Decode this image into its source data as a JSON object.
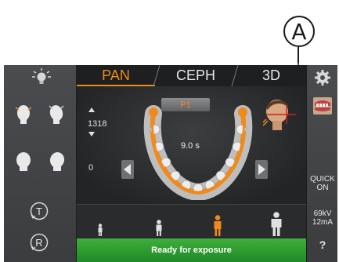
{
  "callout": {
    "label": "A"
  },
  "tabs": [
    {
      "label": "PAN",
      "active": true
    },
    {
      "label": "CEPH",
      "active": false
    },
    {
      "label": "3D",
      "active": false
    }
  ],
  "main": {
    "program": "P1",
    "height_value": "1318",
    "position_value": "0",
    "exposure_time": "9.0 s"
  },
  "right_panel": {
    "quick": "QUICK",
    "on": "ON",
    "kv": "69kV",
    "ma": "12mA",
    "help": "?"
  },
  "left_panel": {
    "t_label": "T",
    "r_label": "R"
  },
  "status": {
    "text": "Ready for exposure"
  },
  "colors": {
    "accent": "#f08a1c",
    "ready": "#2e9e32",
    "panel": "#444648"
  },
  "icons": [
    "light-icon",
    "settings-gear-icon",
    "head-front-icon",
    "head-tilt-icon",
    "patient-size-icon"
  ]
}
